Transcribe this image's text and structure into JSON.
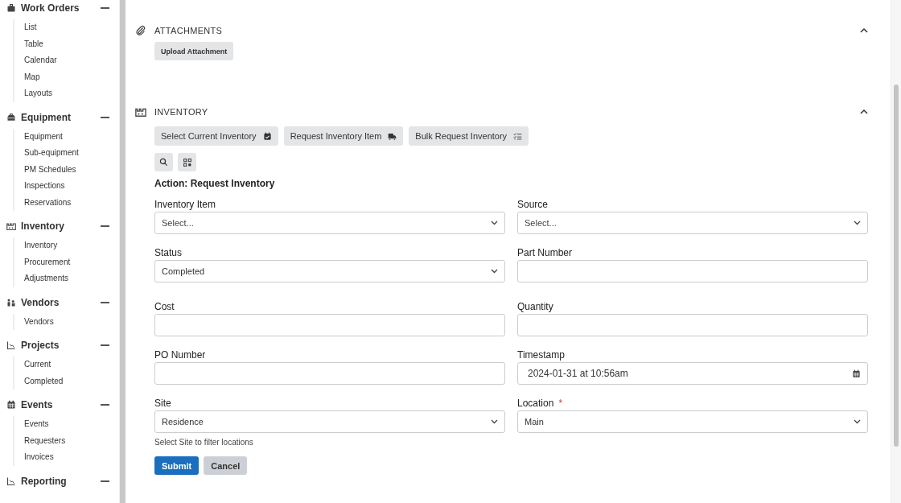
{
  "sidebar": {
    "groups": [
      {
        "title": "Work Orders",
        "expanded": true,
        "items": [
          "List",
          "Table",
          "Calendar",
          "Map",
          "Layouts"
        ]
      },
      {
        "title": "Equipment",
        "expanded": true,
        "items": [
          "Equipment",
          "Sub-equipment",
          "PM Schedules",
          "Inspections",
          "Reservations"
        ]
      },
      {
        "title": "Inventory",
        "expanded": true,
        "items": [
          "Inventory",
          "Procurement",
          "Adjustments"
        ]
      },
      {
        "title": "Vendors",
        "expanded": true,
        "items": [
          "Vendors"
        ]
      },
      {
        "title": "Projects",
        "expanded": true,
        "items": [
          "Current",
          "Completed"
        ]
      },
      {
        "title": "Events",
        "expanded": true,
        "items": [
          "Events",
          "Requesters",
          "Invoices"
        ]
      },
      {
        "title": "Reporting",
        "expanded": true
      }
    ]
  },
  "attachments": {
    "title": "ATTACHMENTS",
    "expanded": true,
    "buttons": [
      "Upload Attachment"
    ]
  },
  "inventory": {
    "title": "INVENTORY",
    "expanded": true,
    "actions": [
      "Select Current Inventory",
      "Request Inventory Item",
      "Bulk Request Inventory"
    ],
    "action_title": "Action: Request Inventory",
    "fields": [
      {
        "label": "Inventory Item",
        "kind": "select",
        "placeholder": "Select..."
      },
      {
        "label": "Source",
        "kind": "select",
        "placeholder": "Select..."
      },
      {
        "label": "Status",
        "kind": "select",
        "value": "Completed"
      },
      {
        "label": "Part Number",
        "kind": "input"
      },
      {
        "label": "Cost",
        "kind": "input"
      },
      {
        "label": "Quantity",
        "kind": "input"
      },
      {
        "label": "PO Number",
        "kind": "input"
      },
      {
        "label": "Timestamp",
        "kind": "date",
        "value": "2024-01-31 at 10:56am"
      },
      {
        "label": "Site",
        "kind": "select",
        "value": "Residence",
        "hint": "Select Site to filter locations"
      },
      {
        "label": "Location",
        "kind": "select",
        "value": "Main",
        "required_mark": "*"
      }
    ],
    "submit": "Submit",
    "cancel": "Cancel"
  }
}
